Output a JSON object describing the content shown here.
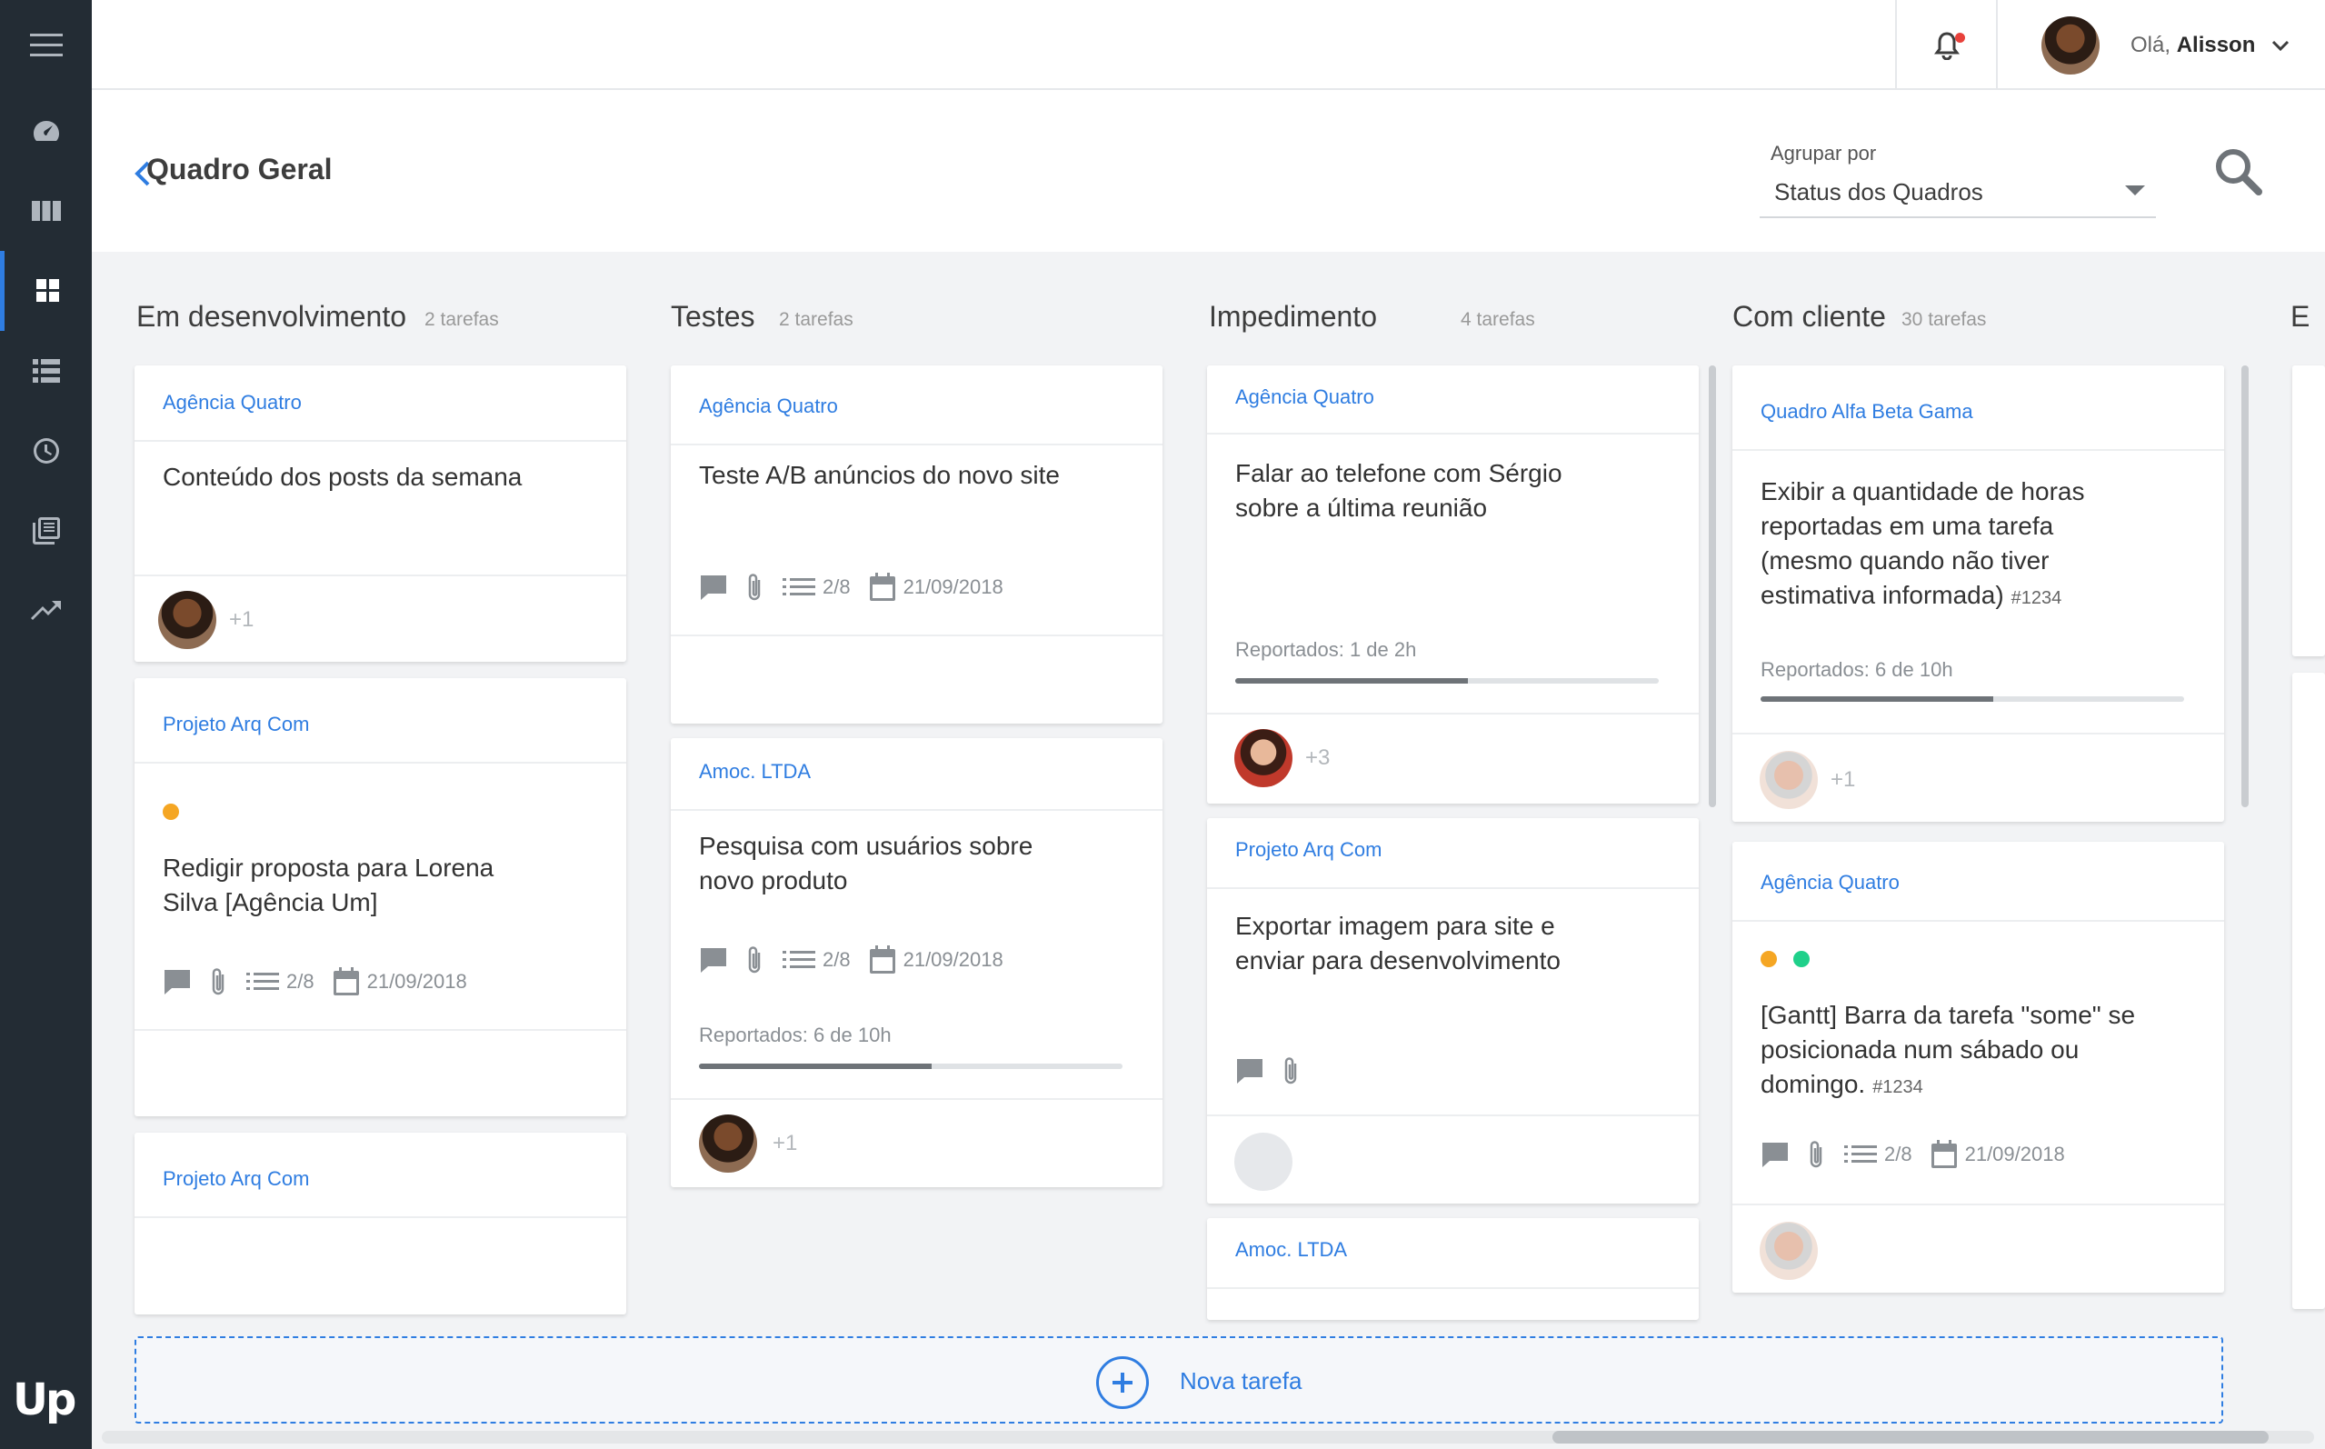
{
  "topbar": {
    "greeting": "Olá,",
    "user_name": "Alisson"
  },
  "header": {
    "title": "Quadro Geral",
    "group_label": "Agrupar por",
    "group_value": "Status dos Quadros"
  },
  "columns": [
    {
      "title": "Em desenvolvimento",
      "count": "2 tarefas",
      "cards": [
        {
          "project": "Agência Quatro",
          "text": "Conteúdo dos posts da semana",
          "extra": "+1"
        },
        {
          "project": "Projeto Arq Com",
          "text_l1": "Redigir proposta para Lorena",
          "text_l2": "Silva [Agência Um]",
          "checklist": "2/8",
          "date": "21/09/2018"
        },
        {
          "project": "Projeto Arq Com"
        }
      ]
    },
    {
      "title": "Testes",
      "count": "2 tarefas",
      "cards": [
        {
          "project": "Agência Quatro",
          "text": "Teste A/B anúncios do novo site",
          "checklist": "2/8",
          "date": "21/09/2018"
        },
        {
          "project": "Amoc. LTDA",
          "text_l1": "Pesquisa com usuários sobre",
          "text_l2": "novo produto",
          "checklist": "2/8",
          "date": "21/09/2018",
          "reported": "Reportados: 6 de 10h",
          "progress": 0.55,
          "extra": "+1"
        }
      ]
    },
    {
      "title": "Impedimento",
      "count": "4 tarefas",
      "cards": [
        {
          "project": "Agência Quatro",
          "text_l1": "Falar ao telefone com Sérgio",
          "text_l2": "sobre a última reunião",
          "reported": "Reportados: 1 de 2h",
          "progress": 0.55,
          "extra": "+3"
        },
        {
          "project": "Projeto Arq Com",
          "text_l1": "Exportar imagem para site e",
          "text_l2": "enviar para desenvolvimento"
        },
        {
          "project": "Amoc. LTDA"
        }
      ]
    },
    {
      "title": "Com cliente",
      "count": "30 tarefas",
      "cards": [
        {
          "project": "Quadro Alfa Beta Gama",
          "text_l1": "Exibir a quantidade de horas",
          "text_l2": "reportadas em uma tarefa",
          "text_l3": "(mesmo quando não tiver",
          "text_l4": "estimativa informada)",
          "ref": "#1234",
          "reported": "Reportados: 6 de 10h",
          "progress": 0.55,
          "extra": "+1"
        },
        {
          "project": "Agência Quatro",
          "text_l1": "[Gantt] Barra da tarefa \"some\"  se",
          "text_l2": "posicionada num sábado ou",
          "text_l3": "domingo.",
          "ref": "#1234",
          "checklist": "2/8",
          "date": "21/09/2018"
        }
      ]
    },
    {
      "title": "E"
    }
  ],
  "new_task": {
    "label": "Nova tarefa"
  },
  "colors": {
    "accent": "#2f7de1",
    "sidebar": "#232c34",
    "tag_orange": "#f5a623",
    "tag_green": "#1fd08a"
  }
}
